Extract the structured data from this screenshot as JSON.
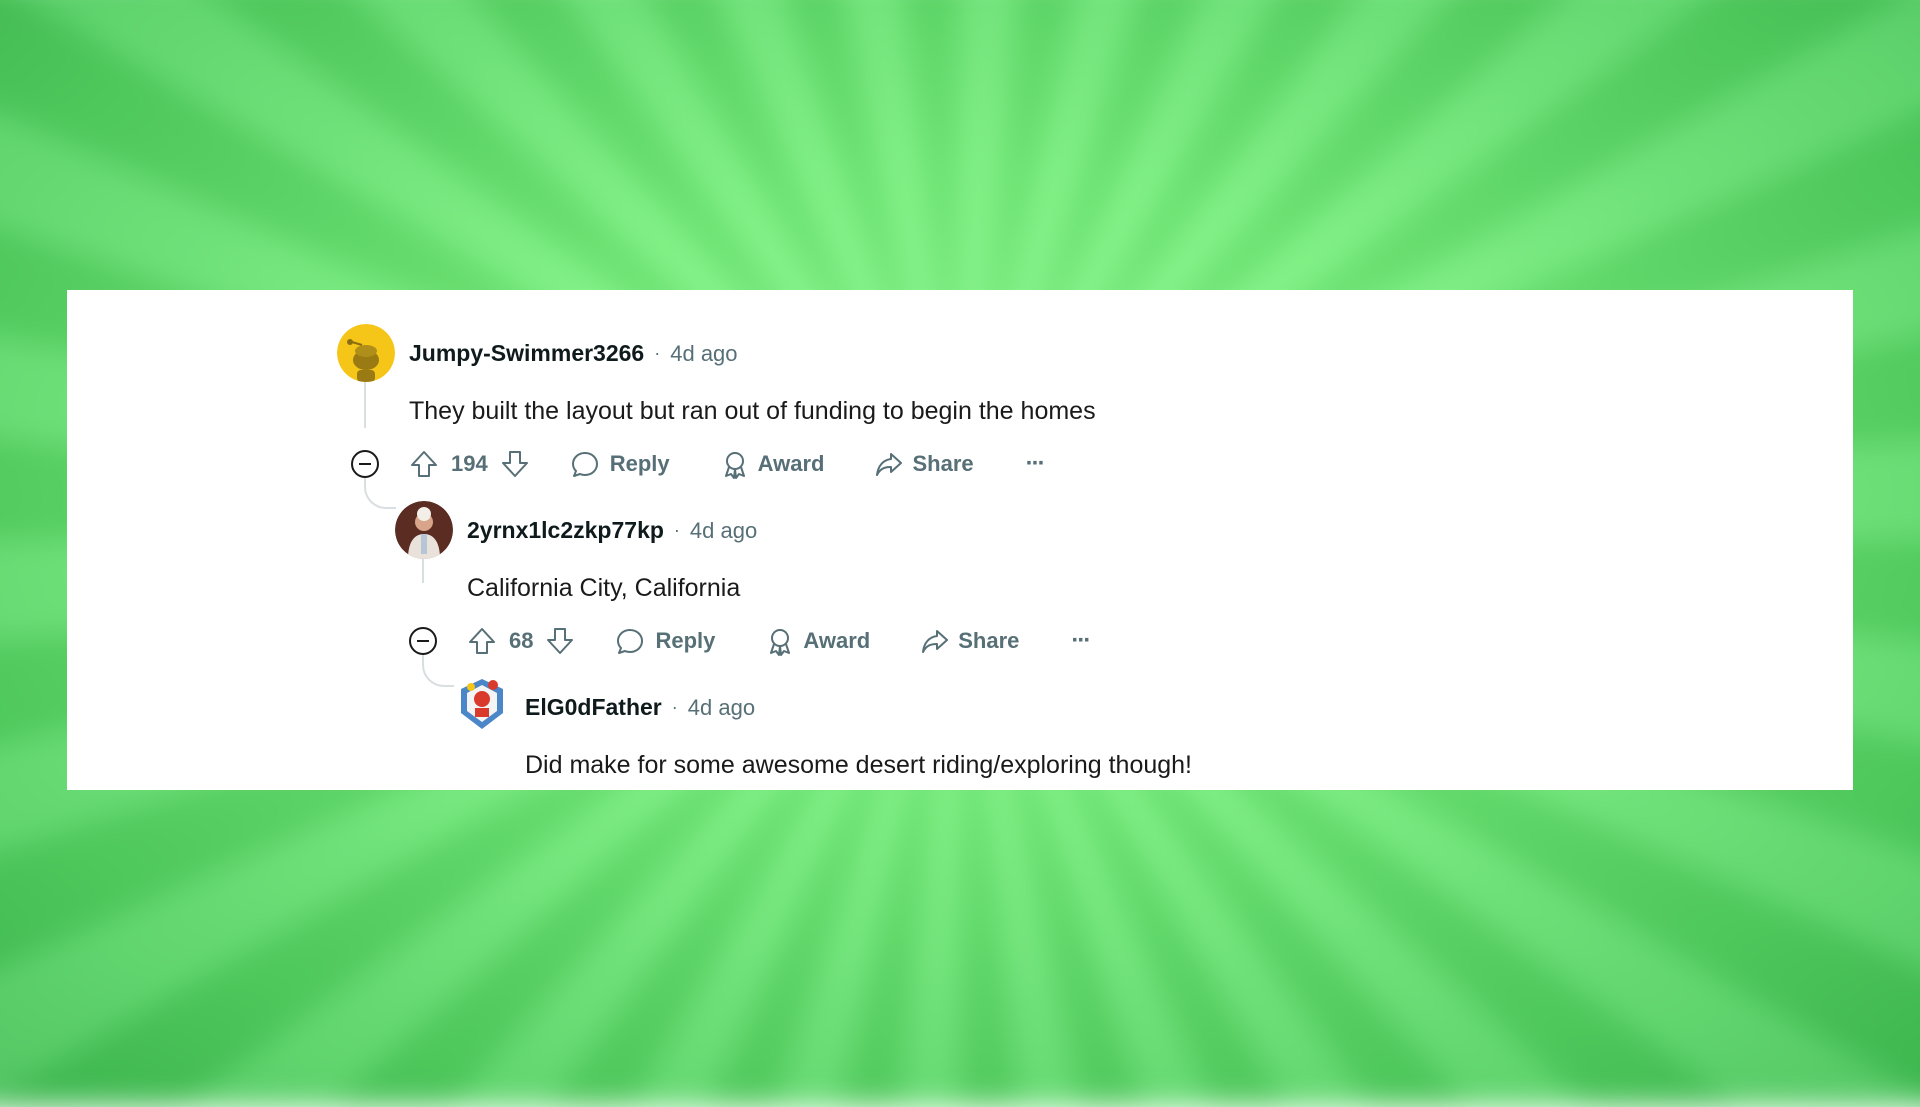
{
  "comments": [
    {
      "username": "Jumpy-Swimmer3266",
      "time": "4d ago",
      "body": "They built the layout but ran out of funding to begin the homes",
      "score": "194",
      "reply_label": "Reply",
      "award_label": "Award",
      "share_label": "Share",
      "more_label": "···"
    },
    {
      "username": "2yrnx1lc2zkp77kp",
      "time": "4d ago",
      "body": "California City, California",
      "score": "68",
      "reply_label": "Reply",
      "award_label": "Award",
      "share_label": "Share",
      "more_label": "···"
    },
    {
      "username": "ElG0dFather",
      "time": "4d ago",
      "body": "Did make for some awesome desert riding/exploring though!"
    }
  ],
  "separator": "·",
  "colors": {
    "background": "#74f07a",
    "card": "#ffffff",
    "text": "#1a1a1b",
    "muted": "#576f76",
    "avatar_yellow": "#f5c518"
  },
  "icons": [
    "snoo-avatar-icon",
    "collapse-icon",
    "upvote-icon",
    "downvote-icon",
    "comment-icon",
    "award-icon",
    "share-icon",
    "more-icon"
  ]
}
